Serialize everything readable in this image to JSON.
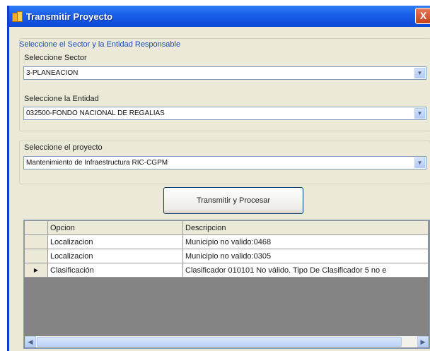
{
  "window": {
    "title": "Transmitir Proyecto",
    "close_symbol": "X"
  },
  "group1": {
    "title": "Seleccione el Sector y la Entidad Responsable",
    "sector_label": "Seleccione Sector",
    "sector_value": "3-PLANEACION",
    "entity_label": "Seleccione la Entidad",
    "entity_value": "032500-FONDO NACIONAL DE REGALIAS"
  },
  "group2": {
    "project_label": "Seleccione el proyecto",
    "project_value": "Mantenimiento de Infraestructura RIC-CGPM"
  },
  "button": {
    "label": "Transmitir y Procesar"
  },
  "grid": {
    "columns": [
      "Opcion",
      "Descripcion"
    ],
    "rows": [
      {
        "indicator": "",
        "opcion": "Localizacion",
        "descripcion": "Municipio no valido:0468"
      },
      {
        "indicator": "",
        "opcion": "Localizacion",
        "descripcion": "Municipio no valido:0305"
      },
      {
        "indicator": "▶",
        "opcion": "Clasificación",
        "descripcion": "Clasificador 010101 No válido. Tipo De Clasificador 5 no e"
      }
    ]
  },
  "icons": {
    "dropdown": "chevron-down-icon",
    "scroll_left": "scroll-left-icon",
    "scroll_right": "scroll-right-icon"
  },
  "colors": {
    "titlebar": "#1a5ee8",
    "group_title": "#1c4bb8",
    "grid_empty": "#848484"
  }
}
